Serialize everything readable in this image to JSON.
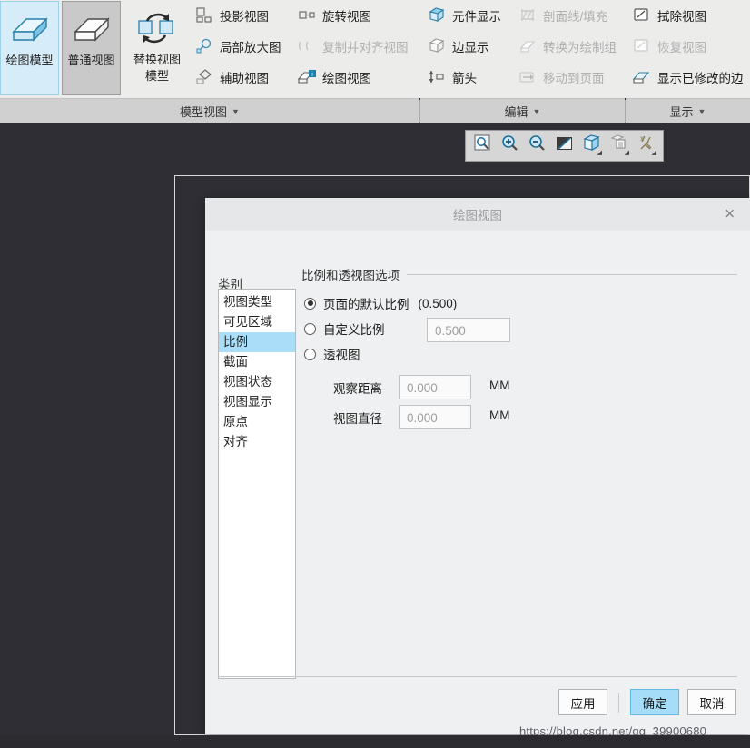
{
  "ribbon": {
    "groups": [
      {
        "name": "模型视图",
        "footer_label": "模型视图",
        "big_buttons": [
          {
            "label": "绘图模型",
            "icon": "drawing-model-icon",
            "state": "selected"
          },
          {
            "label": "普通视图",
            "icon": "general-view-icon",
            "state": "pressed"
          },
          {
            "label": "替换视图\n模型",
            "icon": "replace-view-model-icon",
            "state": "normal"
          }
        ],
        "small_buttons": [
          {
            "label": "投影视图",
            "icon": "projection-view-icon",
            "disabled": false
          },
          {
            "label": "旋转视图",
            "icon": "rotate-view-icon",
            "disabled": false
          },
          {
            "label": "局部放大图",
            "icon": "detailed-view-icon",
            "disabled": false
          },
          {
            "label": "复制并对齐视图",
            "icon": "copy-align-view-icon",
            "disabled": true
          },
          {
            "label": "辅助视图",
            "icon": "auxiliary-view-icon",
            "disabled": false
          },
          {
            "label": "绘图视图",
            "icon": "drawing-view-icon",
            "disabled": false
          }
        ]
      },
      {
        "name": "编辑",
        "footer_label": "编辑",
        "small_buttons": [
          {
            "label": "元件显示",
            "icon": "component-display-icon",
            "disabled": false
          },
          {
            "label": "剖面线/填充",
            "icon": "hatch-fill-icon",
            "disabled": true
          },
          {
            "label": "边显示",
            "icon": "edge-display-icon",
            "disabled": false
          },
          {
            "label": "转换为绘制组",
            "icon": "convert-to-draft-group-icon",
            "disabled": true
          },
          {
            "label": "箭头",
            "icon": "arrow-icon",
            "disabled": false
          },
          {
            "label": "移动到页面",
            "icon": "move-to-sheet-icon",
            "disabled": true
          }
        ]
      },
      {
        "name": "显示",
        "footer_label": "显示",
        "small_buttons": [
          {
            "label": "拭除视图",
            "icon": "erase-view-icon",
            "disabled": false
          },
          {
            "label": "恢复视图",
            "icon": "restore-view-icon",
            "disabled": true
          },
          {
            "label": "显示已修改的边",
            "icon": "show-modified-edges-icon",
            "disabled": false
          }
        ]
      }
    ]
  },
  "view_toolbar": {
    "buttons": [
      {
        "icon": "zoom-fit-icon",
        "has_dropdown": false
      },
      {
        "icon": "zoom-in-icon",
        "has_dropdown": false
      },
      {
        "icon": "zoom-out-icon",
        "has_dropdown": false
      },
      {
        "icon": "repaint-icon",
        "has_dropdown": false
      },
      {
        "icon": "display-style-icon",
        "has_dropdown": true
      },
      {
        "icon": "layers-icon",
        "has_dropdown": true
      },
      {
        "icon": "datum-display-icon",
        "has_dropdown": true
      }
    ]
  },
  "dialog": {
    "title": "绘图视图",
    "close_label": "✕",
    "category_label": "类别",
    "categories": [
      {
        "label": "视图类型",
        "selected": false
      },
      {
        "label": "可见区域",
        "selected": false
      },
      {
        "label": "比例",
        "selected": true
      },
      {
        "label": "截面",
        "selected": false
      },
      {
        "label": "视图状态",
        "selected": false
      },
      {
        "label": "视图显示",
        "selected": false
      },
      {
        "label": "原点",
        "selected": false
      },
      {
        "label": "对齐",
        "selected": false
      }
    ],
    "section_title": "比例和透视图选项",
    "options": {
      "default_scale": {
        "label": "页面的默认比例",
        "value": "(0.500)",
        "checked": true
      },
      "custom_scale": {
        "label": "自定义比例",
        "checked": false,
        "field_value": "0.500"
      },
      "perspective": {
        "label": "透视图",
        "checked": false
      }
    },
    "fields": [
      {
        "label": "观察距离",
        "value": "0.000",
        "unit": "MM"
      },
      {
        "label": "视图直径",
        "value": "0.000",
        "unit": "MM"
      }
    ],
    "buttons": {
      "apply": "应用",
      "ok": "确定",
      "cancel": "取消"
    }
  },
  "watermark": "https://blog.csdn.net/qq_39900680",
  "colors": {
    "accent_blue": "#a5dcf7",
    "selection_blue": "#aaddf7",
    "ribbon_bg": "#ececeb",
    "canvas_bg": "#2e2e34",
    "dialog_bg": "#eff0f1"
  }
}
